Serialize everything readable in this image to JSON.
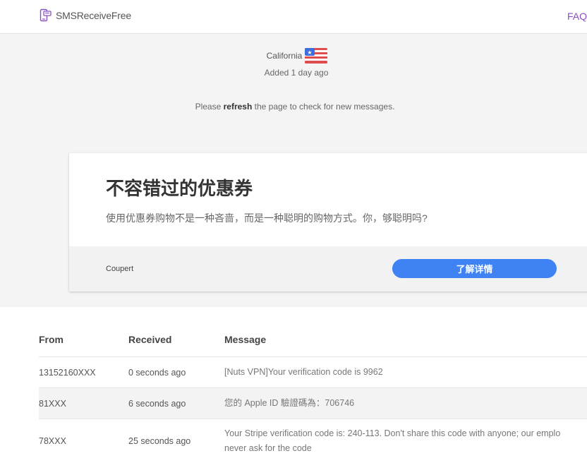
{
  "header": {
    "logo_text": "SMSReceiveFree",
    "faq_label": "FAQ"
  },
  "info": {
    "location": "California",
    "added": "Added 1 day ago",
    "notice_prefix": "Please ",
    "notice_bold": "refresh",
    "notice_suffix": " the page to check for new messages."
  },
  "ad": {
    "title": "不容错过的优惠券",
    "description": "使用优惠券购物不是一种吝啬，而是一种聪明的购物方式。你，够聪明吗?",
    "brand": "Coupert",
    "button_label": "了解详情",
    "button_color": "#3f82f3"
  },
  "table": {
    "headers": {
      "from": "From",
      "received": "Received",
      "message": "Message"
    },
    "rows": [
      {
        "from": "13152160XXX",
        "received": "0 seconds ago",
        "message": "[Nuts VPN]Your verification code is 9962"
      },
      {
        "from": "81XXX",
        "received": "6 seconds ago",
        "message": "您的 Apple ID 驗證碼為：706746"
      },
      {
        "from": "78XXX",
        "received": "25 seconds ago",
        "message_line1": "Your Stripe verification code is: 240-113. Don't share this code with anyone; our emplo",
        "message_line2": "never ask for the code"
      }
    ]
  },
  "colors": {
    "faq": "#8a4fc7",
    "band": "#f4f4f5"
  }
}
